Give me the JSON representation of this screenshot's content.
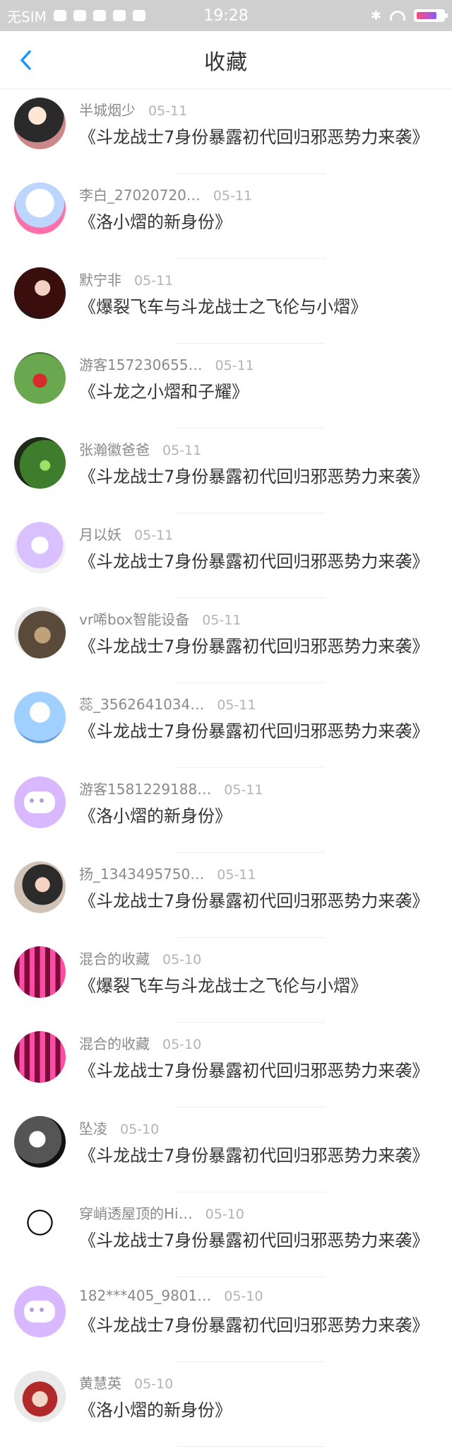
{
  "status": {
    "carrier": "无SIM",
    "time": "19:28"
  },
  "header": {
    "title": "收藏"
  },
  "items": [
    {
      "name": "半城烟少",
      "date": "05-11",
      "content": "《斗龙战士7身份暴露初代回归邪恶势力来袭》"
    },
    {
      "name": "李白_27020720…",
      "date": "05-11",
      "content": "《洛小熠的新身份》"
    },
    {
      "name": "默宁非",
      "date": "05-11",
      "content": "《爆裂飞车与斗龙战士之飞伦与小熠》"
    },
    {
      "name": "游客157230655…",
      "date": "05-11",
      "content": "《斗龙之小熠和子耀》"
    },
    {
      "name": "张瀚徽爸爸",
      "date": "05-11",
      "content": "《斗龙战士7身份暴露初代回归邪恶势力来袭》"
    },
    {
      "name": "月以妖",
      "date": "05-11",
      "content": "《斗龙战士7身份暴露初代回归邪恶势力来袭》"
    },
    {
      "name": "vr唏box智能设备",
      "date": "05-11",
      "content": "《斗龙战士7身份暴露初代回归邪恶势力来袭》"
    },
    {
      "name": "蕊_3562641034…",
      "date": "05-11",
      "content": "《斗龙战士7身份暴露初代回归邪恶势力来袭》"
    },
    {
      "name": "游客1581229188…",
      "date": "05-11",
      "content": "《洛小熠的新身份》"
    },
    {
      "name": "扬_1343495750…",
      "date": "05-11",
      "content": "《斗龙战士7身份暴露初代回归邪恶势力来袭》"
    },
    {
      "name": "混合的收藏",
      "date": "05-10",
      "content": "《爆裂飞车与斗龙战士之飞伦与小熠》"
    },
    {
      "name": "混合的收藏",
      "date": "05-10",
      "content": "《斗龙战士7身份暴露初代回归邪恶势力来袭》"
    },
    {
      "name": "坠凌",
      "date": "05-10",
      "content": "《斗龙战士7身份暴露初代回归邪恶势力来袭》"
    },
    {
      "name": "穿峭透屋顶的Hi…",
      "date": "05-10",
      "content": "《斗龙战士7身份暴露初代回归邪恶势力来袭》"
    },
    {
      "name": "182***405_9801…",
      "date": "05-10",
      "content": "《斗龙战士7身份暴露初代回归邪恶势力来袭》"
    },
    {
      "name": "黄慧英",
      "date": "05-10",
      "content": "《洛小熠的新身份》"
    }
  ],
  "colors": {
    "accent": "#1a96ff",
    "statusbar": "#cfcfcf"
  }
}
